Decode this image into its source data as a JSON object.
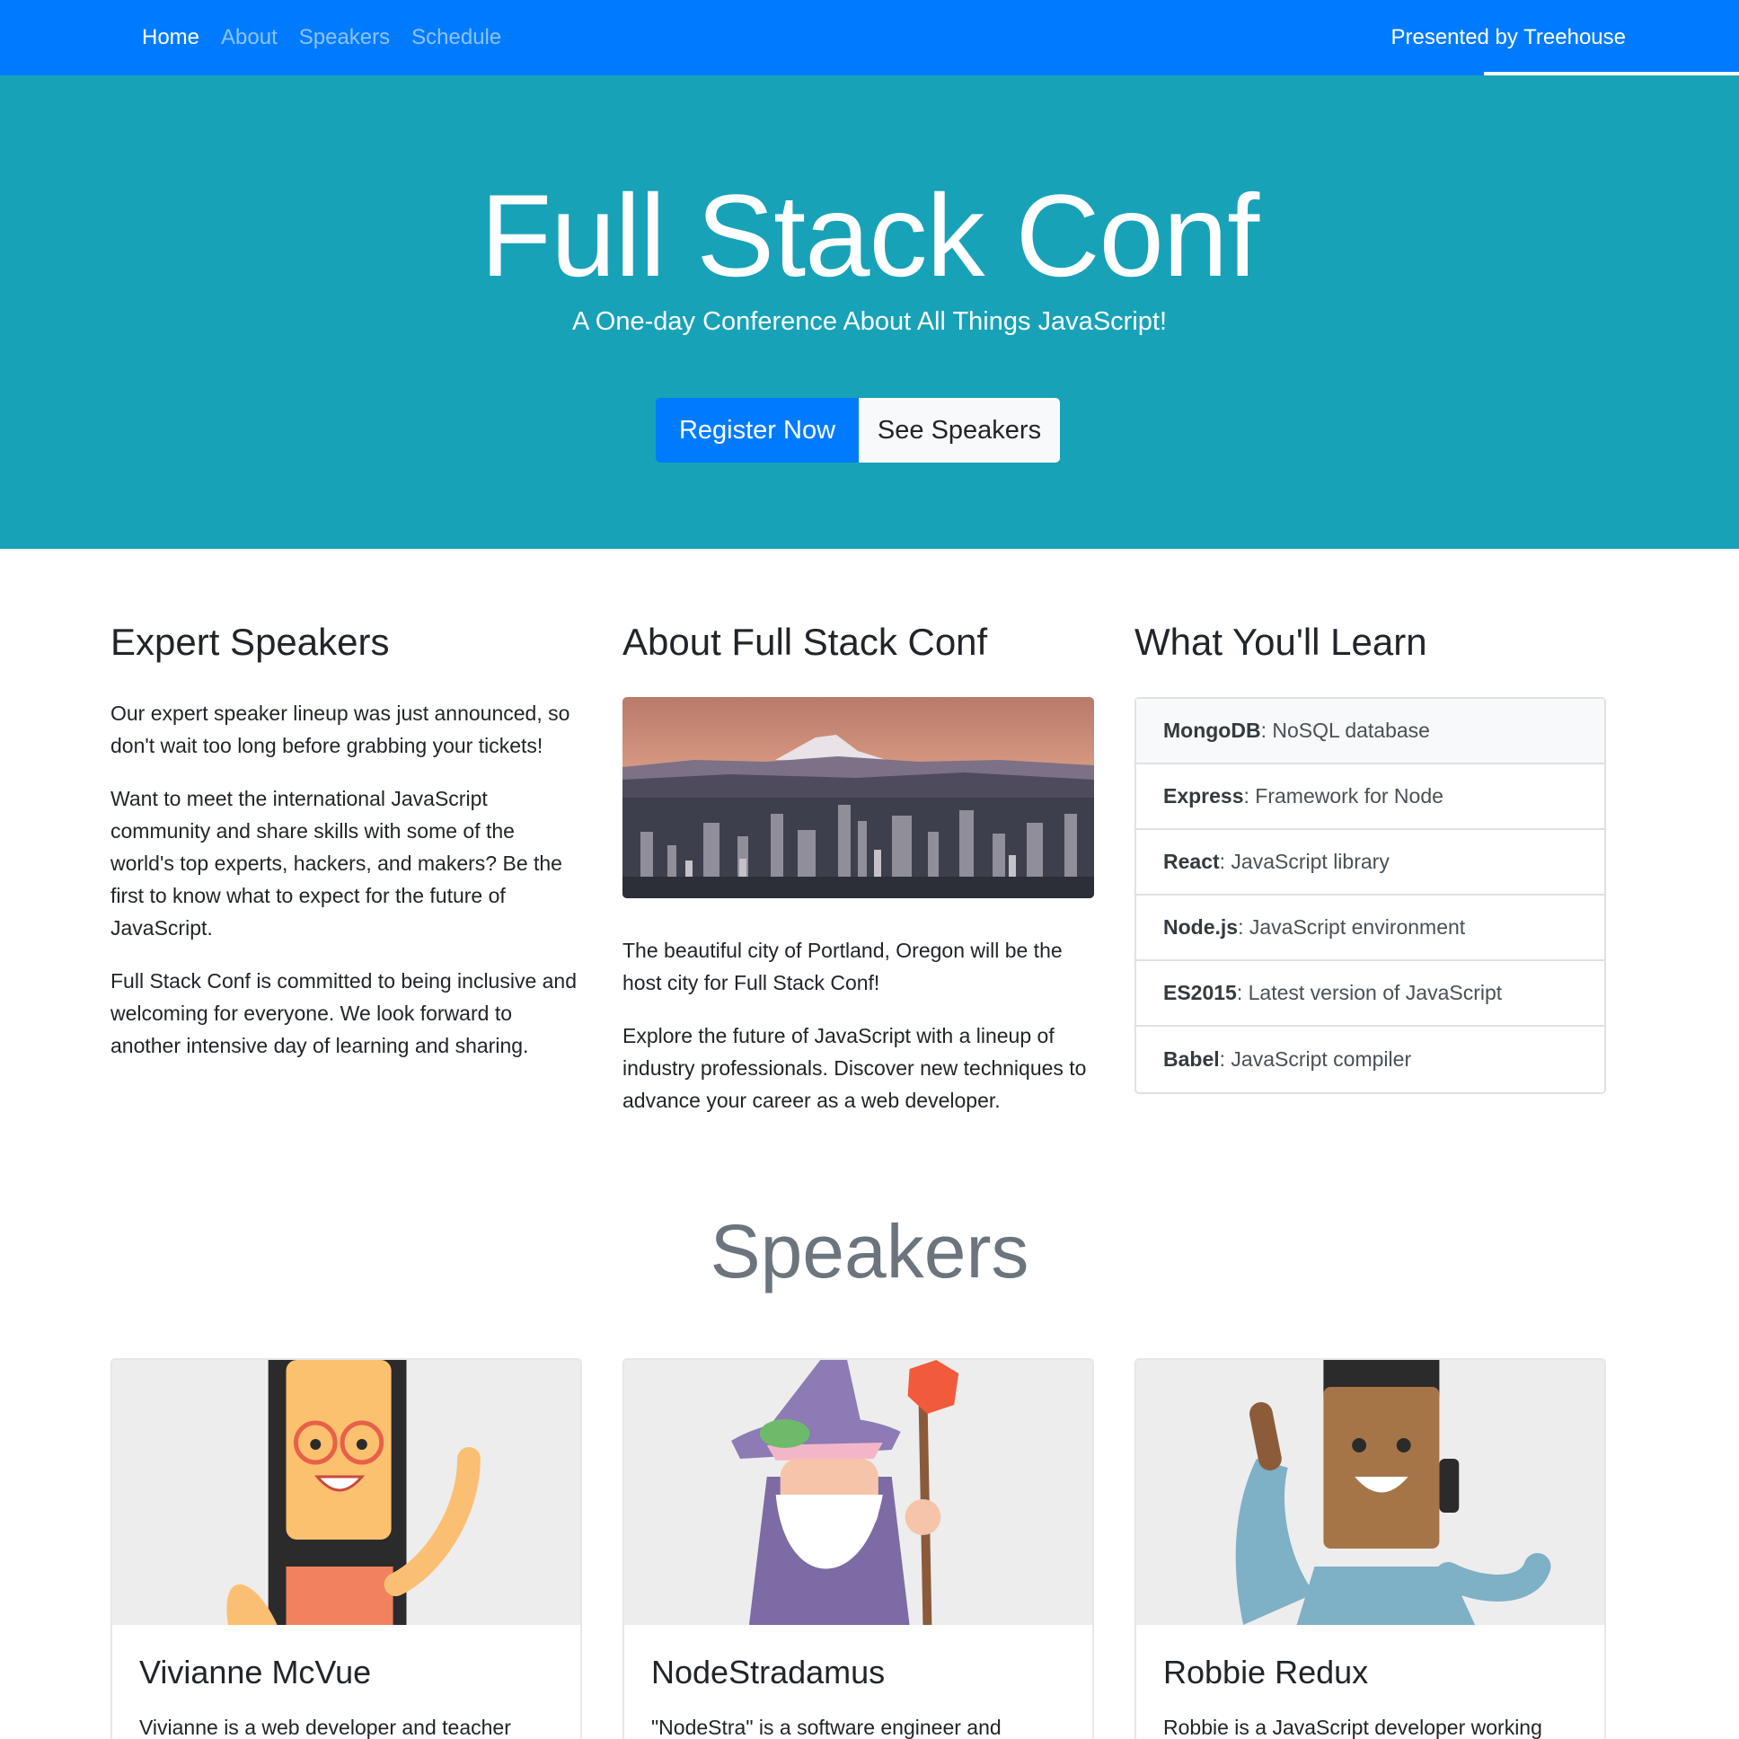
{
  "nav": {
    "links": [
      "Home",
      "About",
      "Speakers",
      "Schedule"
    ],
    "presented_by": "Presented by Treehouse"
  },
  "hero": {
    "title": "Full Stack Conf",
    "subtitle": "A One-day Conference About All Things JavaScript!",
    "register_label": "Register Now",
    "speakers_label": "See Speakers"
  },
  "expert": {
    "heading": "Expert Speakers",
    "paragraphs": [
      "Our expert speaker lineup was just announced, so don't wait too long before grabbing your tickets!",
      "Want to meet the international JavaScript community and share skills with some of the world's top experts, hackers, and makers? Be the first to know what to expect for the future of JavaScript.",
      "Full Stack Conf is committed to being inclusive and welcoming for everyone. We look forward to another intensive day of learning and sharing."
    ]
  },
  "about": {
    "heading": "About Full Stack Conf",
    "paragraphs": [
      "The beautiful city of Portland, Oregon will be the host city for Full Stack Conf!",
      "Explore the future of JavaScript with a lineup of industry professionals. Discover new techniques to advance your career as a web developer."
    ]
  },
  "learn": {
    "heading": "What You'll Learn",
    "items": [
      {
        "name": "MongoDB",
        "desc": ": NoSQL database"
      },
      {
        "name": "Express",
        "desc": ": Framework for Node"
      },
      {
        "name": "React",
        "desc": ": JavaScript library"
      },
      {
        "name": "Node.js",
        "desc": ": JavaScript environment"
      },
      {
        "name": "ES2015",
        "desc": ": Latest version of JavaScript"
      },
      {
        "name": "Babel",
        "desc": ": JavaScript compiler"
      }
    ]
  },
  "speakers": {
    "heading": "Speakers",
    "cards": [
      {
        "name": "Vivianne McVue",
        "bio": "Vivianne is a web developer and teacher"
      },
      {
        "name": "NodeStradamus",
        "bio": "\"NodeStra\" is a software engineer and"
      },
      {
        "name": "Robbie Redux",
        "bio": "Robbie is a JavaScript developer working"
      }
    ]
  }
}
